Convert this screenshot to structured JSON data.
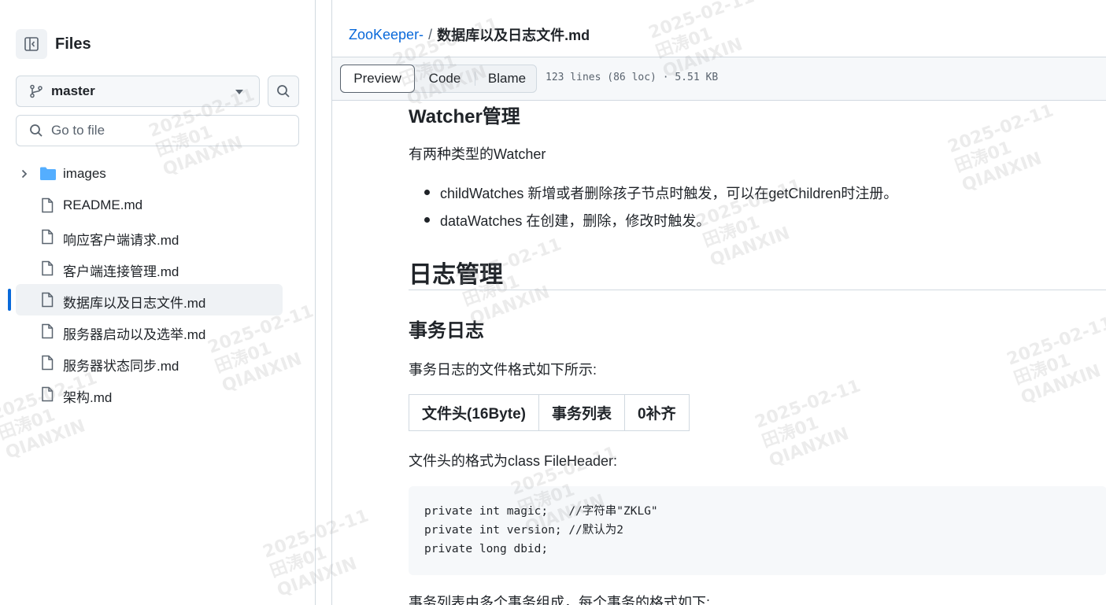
{
  "sidebar": {
    "title": "Files",
    "branch": "master",
    "goto_placeholder": "Go to file",
    "items": [
      {
        "label": "images",
        "type": "folder"
      },
      {
        "label": "README.md",
        "type": "file"
      },
      {
        "label": "响应客户端请求.md",
        "type": "file"
      },
      {
        "label": "客户端连接管理.md",
        "type": "file"
      },
      {
        "label": "数据库以及日志文件.md",
        "type": "file",
        "active": true
      },
      {
        "label": "服务器启动以及选举.md",
        "type": "file"
      },
      {
        "label": "服务器状态同步.md",
        "type": "file"
      },
      {
        "label": "架构.md",
        "type": "file"
      }
    ]
  },
  "breadcrumb": {
    "repo": "ZooKeeper-",
    "separator": "/",
    "file": "数据库以及日志文件.md"
  },
  "toolbar": {
    "tabs": [
      "Preview",
      "Code",
      "Blame"
    ],
    "meta": "123 lines (86 loc) · 5.51 KB"
  },
  "content": {
    "watcher_heading": "Watcher管理",
    "watcher_intro": "有两种类型的Watcher",
    "watcher_items": [
      "childWatches 新增或者删除孩子节点时触发，可以在getChildren时注册。",
      "dataWatches 在创建，删除，修改时触发。"
    ],
    "log_heading": "日志管理",
    "txlog_heading": "事务日志",
    "txlog_intro": "事务日志的文件格式如下所示:",
    "table_headers": [
      "文件头(16Byte)",
      "事务列表",
      "0补齐"
    ],
    "header_intro": "文件头的格式为class FileHeader:",
    "code_lines": [
      "private int magic;   //字符串\"ZKLG\"",
      "private int version; //默认为2",
      "private long dbid;"
    ],
    "tail_text": "事务列表由多个事务组成，每个事务的格式如下:"
  },
  "watermark": {
    "date": "2025-02-11",
    "name": "田涛01",
    "org": "QIANXIN"
  },
  "colors": {
    "accent": "#0969da",
    "border": "#d1d9e0",
    "text": "#1f2328",
    "muted": "#59636e",
    "folder": "#54aeff"
  }
}
